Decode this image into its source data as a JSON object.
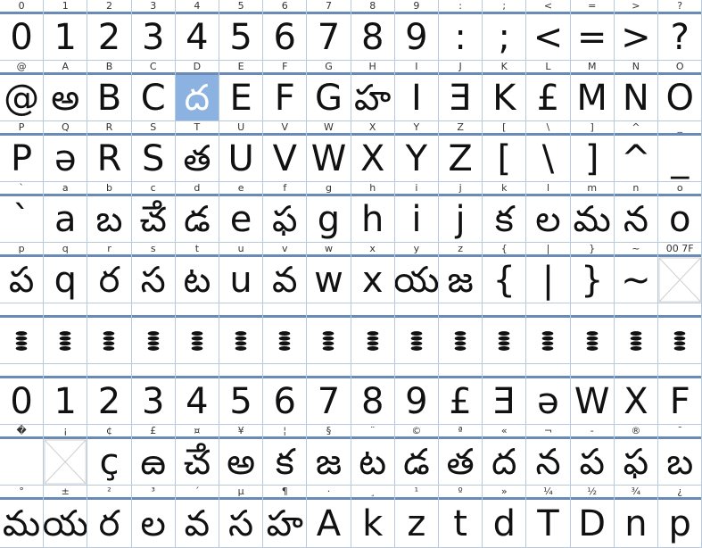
{
  "grid": {
    "rows": [
      {
        "cells": [
          [
            "0",
            "0"
          ],
          [
            "1",
            "1"
          ],
          [
            "2",
            "2"
          ],
          [
            "3",
            "3"
          ],
          [
            "4",
            "4"
          ],
          [
            "5",
            "5"
          ],
          [
            "6",
            "6"
          ],
          [
            "7",
            "7"
          ],
          [
            "8",
            "8"
          ],
          [
            "9",
            "9"
          ],
          [
            ":",
            ":"
          ],
          [
            ";",
            ";"
          ],
          [
            "<",
            "<"
          ],
          [
            "=",
            "="
          ],
          [
            ">",
            ">"
          ],
          [
            "?",
            "?"
          ]
        ]
      },
      {
        "cells": [
          [
            "@",
            "@"
          ],
          [
            "A",
            "అ"
          ],
          [
            "B",
            "B"
          ],
          [
            "C",
            "C"
          ],
          [
            "D",
            "ద"
          ],
          [
            "E",
            "E"
          ],
          [
            "F",
            "F"
          ],
          [
            "G",
            "G"
          ],
          [
            "H",
            "హ"
          ],
          [
            "I",
            "I"
          ],
          [
            "J",
            "Ǝ"
          ],
          [
            "K",
            "K"
          ],
          [
            "L",
            "£"
          ],
          [
            "M",
            "M"
          ],
          [
            "N",
            "N"
          ],
          [
            "O",
            "O"
          ]
        ]
      },
      {
        "cells": [
          [
            "P",
            "P"
          ],
          [
            "Q",
            "ə"
          ],
          [
            "R",
            "R"
          ],
          [
            "S",
            "S"
          ],
          [
            "T",
            "త"
          ],
          [
            "U",
            "U"
          ],
          [
            "V",
            "V"
          ],
          [
            "W",
            "W"
          ],
          [
            "X",
            "X"
          ],
          [
            "Y",
            "Y"
          ],
          [
            "Z",
            "Z"
          ],
          [
            "[",
            "["
          ],
          [
            "\\",
            "\\"
          ],
          [
            "]",
            "]"
          ],
          [
            "^",
            "^"
          ],
          [
            "_",
            "_"
          ]
        ]
      },
      {
        "cells": [
          [
            "`",
            "`"
          ],
          [
            "a",
            "a"
          ],
          [
            "b",
            "బ"
          ],
          [
            "c",
            "ౘ"
          ],
          [
            "d",
            "డ"
          ],
          [
            "e",
            "e"
          ],
          [
            "f",
            "ఫ"
          ],
          [
            "g",
            "g"
          ],
          [
            "h",
            "h"
          ],
          [
            "i",
            "i"
          ],
          [
            "j",
            "j"
          ],
          [
            "k",
            "క"
          ],
          [
            "l",
            "ల"
          ],
          [
            "m",
            "మ"
          ],
          [
            "n",
            "న"
          ],
          [
            "o",
            "o"
          ]
        ]
      },
      {
        "cells": [
          [
            "p",
            "ప"
          ],
          [
            "q",
            "q"
          ],
          [
            "r",
            "ర"
          ],
          [
            "s",
            "స"
          ],
          [
            "t",
            "ట"
          ],
          [
            "u",
            "u"
          ],
          [
            "v",
            "వ"
          ],
          [
            "w",
            "w"
          ],
          [
            "x",
            "x"
          ],
          [
            "y",
            "య"
          ],
          [
            "z",
            "జ"
          ],
          [
            "{",
            "{"
          ],
          [
            "|",
            "|"
          ],
          [
            "}",
            "}"
          ],
          [
            "~",
            "~"
          ],
          [
            "00 7F",
            ""
          ]
        ]
      },
      {
        "cells": [
          [
            "",
            "8"
          ],
          [
            "",
            "8"
          ],
          [
            "",
            "8"
          ],
          [
            "",
            "8"
          ],
          [
            "",
            "8"
          ],
          [
            "",
            "8"
          ],
          [
            "",
            "8"
          ],
          [
            "",
            "8"
          ],
          [
            "",
            "8"
          ],
          [
            "",
            "8"
          ],
          [
            "",
            "8"
          ],
          [
            "",
            "8"
          ],
          [
            "",
            "8"
          ],
          [
            "",
            "8"
          ],
          [
            "",
            "8"
          ],
          [
            "",
            "8"
          ]
        ]
      },
      {
        "cells": [
          [
            "",
            "0"
          ],
          [
            "",
            "1"
          ],
          [
            "",
            "2"
          ],
          [
            "",
            "3"
          ],
          [
            "",
            "4"
          ],
          [
            "",
            "5"
          ],
          [
            "",
            "6"
          ],
          [
            "",
            "7"
          ],
          [
            "",
            "8"
          ],
          [
            "",
            "9"
          ],
          [
            "",
            "£"
          ],
          [
            "",
            "Ǝ"
          ],
          [
            "",
            "ə"
          ],
          [
            "",
            "W"
          ],
          [
            "",
            "X"
          ],
          [
            "",
            "F"
          ]
        ]
      },
      {
        "cells": [
          [
            "�",
            ""
          ],
          [
            "¡",
            ""
          ],
          [
            "¢",
            "ç"
          ],
          [
            "£",
            "ౚ"
          ],
          [
            "¤",
            "ౘ"
          ],
          [
            "¥",
            "అ"
          ],
          [
            "¦",
            "క"
          ],
          [
            "§",
            "జ"
          ],
          [
            "¨",
            "ట"
          ],
          [
            "©",
            "డ"
          ],
          [
            "ª",
            "త"
          ],
          [
            "«",
            "ద"
          ],
          [
            "¬",
            "న"
          ],
          [
            "-",
            "ప"
          ],
          [
            "®",
            "ఫ"
          ],
          [
            "¯",
            "బ"
          ]
        ]
      },
      {
        "cells": [
          [
            "°",
            "మ"
          ],
          [
            "±",
            "య"
          ],
          [
            "²",
            "ర"
          ],
          [
            "³",
            "ల"
          ],
          [
            "´",
            "వ"
          ],
          [
            "µ",
            "స"
          ],
          [
            "¶",
            "హ"
          ],
          [
            "·",
            "A"
          ],
          [
            "¸",
            "k"
          ],
          [
            "¹",
            "z"
          ],
          [
            "º",
            "t"
          ],
          [
            "»",
            "d"
          ],
          [
            "¼",
            "T"
          ],
          [
            "½",
            "D"
          ],
          [
            "¾",
            "n"
          ],
          [
            "¿",
            "p"
          ]
        ]
      }
    ],
    "highlight": {
      "row": 1,
      "col": 4
    },
    "missing_glyphs": [
      [
        4,
        15
      ],
      [
        7,
        1
      ]
    ]
  }
}
